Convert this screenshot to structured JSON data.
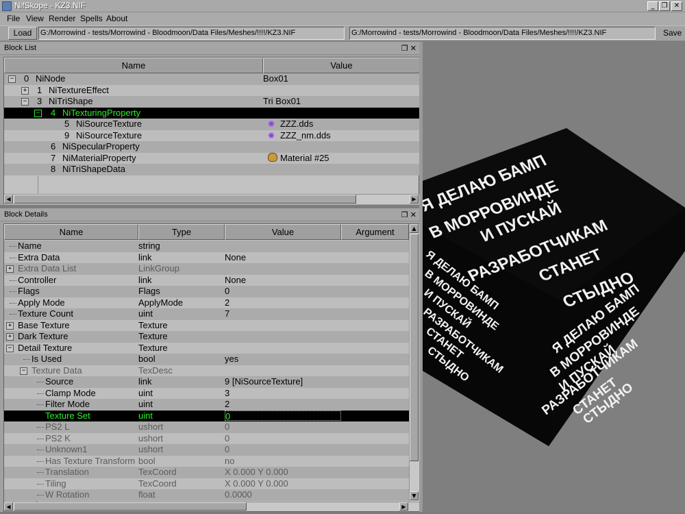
{
  "window": {
    "title": "NifSkope - KZ3.NIF"
  },
  "menu": {
    "items": [
      "File",
      "View",
      "Render",
      "Spells",
      "About"
    ]
  },
  "toolbar": {
    "load_label": "Load",
    "load_path": "G:/Morrowind - tests/Morrowind - Bloodmoon/Data Files/Meshes/!!!!/KZ3.NIF",
    "save_path": "G:/Morrowind - tests/Morrowind - Bloodmoon/Data Files/Meshes/!!!!/KZ3.NIF",
    "save_label": "Save"
  },
  "block_list": {
    "title": "Block List",
    "columns": [
      "Name",
      "Value"
    ],
    "rows": [
      {
        "id": "0",
        "name": "NiNode",
        "value": "Box01"
      },
      {
        "id": "1",
        "name": "NiTextureEffect",
        "value": ""
      },
      {
        "id": "3",
        "name": "NiTriShape",
        "value": "Tri Box01"
      },
      {
        "id": "4",
        "name": "NiTexturingProperty",
        "value": ""
      },
      {
        "id": "5",
        "name": "NiSourceTexture",
        "value": "ZZZ.dds",
        "icon": "texture-icon"
      },
      {
        "id": "9",
        "name": "NiSourceTexture",
        "value": "ZZZ_nm.dds",
        "icon": "texture-icon"
      },
      {
        "id": "6",
        "name": "NiSpecularProperty",
        "value": ""
      },
      {
        "id": "7",
        "name": "NiMaterialProperty",
        "value": "Material #25",
        "icon": "palette-icon"
      },
      {
        "id": "8",
        "name": "NiTriShapeData",
        "value": ""
      }
    ]
  },
  "block_details": {
    "title": "Block Details",
    "columns": [
      "Name",
      "Type",
      "Value",
      "Argument"
    ],
    "rows": [
      {
        "name": "Name",
        "type": "string",
        "value": ""
      },
      {
        "name": "Extra Data",
        "type": "link",
        "value": "None"
      },
      {
        "name": "Extra Data List",
        "type": "LinkGroup",
        "value": ""
      },
      {
        "name": "Controller",
        "type": "link",
        "value": "None"
      },
      {
        "name": "Flags",
        "type": "Flags",
        "value": "0"
      },
      {
        "name": "Apply Mode",
        "type": "ApplyMode",
        "value": "2"
      },
      {
        "name": "Texture Count",
        "type": "uint",
        "value": "7"
      },
      {
        "name": "Base Texture",
        "type": "Texture",
        "value": ""
      },
      {
        "name": "Dark Texture",
        "type": "Texture",
        "value": ""
      },
      {
        "name": "Detail Texture",
        "type": "Texture",
        "value": ""
      },
      {
        "name": "Is Used",
        "type": "bool",
        "value": "yes"
      },
      {
        "name": "Texture Data",
        "type": "TexDesc",
        "value": ""
      },
      {
        "name": "Source",
        "type": "link",
        "value": "9 [NiSourceTexture]"
      },
      {
        "name": "Clamp Mode",
        "type": "uint",
        "value": "3"
      },
      {
        "name": "Filter Mode",
        "type": "uint",
        "value": "2"
      },
      {
        "name": "Texture Set",
        "type": "uint",
        "value": "0"
      },
      {
        "name": "PS2 L",
        "type": "ushort",
        "value": "0"
      },
      {
        "name": "PS2 K",
        "type": "ushort",
        "value": "0"
      },
      {
        "name": "Unknown1",
        "type": "ushort",
        "value": "0"
      },
      {
        "name": "Has Texture Transform",
        "type": "bool",
        "value": "no"
      },
      {
        "name": "Translation",
        "type": "TexCoord",
        "value": "X 0.000 Y 0.000"
      },
      {
        "name": "Tiling",
        "type": "TexCoord",
        "value": "X 0.000 Y 0.000"
      },
      {
        "name": "W Rotation",
        "type": "float",
        "value": "0.0000"
      }
    ]
  },
  "viewport": {
    "front_lines": [
      "Я ДЕЛАЮ БАМП",
      "В МОРРОВИНДЕ",
      "И ПУСКАЙ",
      "РАЗРАБОТЧИКАМ",
      "СТАНЕТ",
      "СТЫДНО"
    ],
    "side_lines": [
      "Я ДЕЛАЮ БАМП",
      "В МОРРОВИНДЕ",
      "И ПУСКАЙ",
      "РАЗРАБОТЧИКАМ",
      "СТАНЕТ",
      "СТЫДНО"
    ],
    "top_lines": [
      "Я ДЕЛАЮ БАМП",
      "В МОРРОВИНДЕ",
      "И ПУСКАЙ",
      "РАЗРАБОТЧИКАМ",
      "СТАНЕТ",
      "СТЫДНО"
    ]
  }
}
